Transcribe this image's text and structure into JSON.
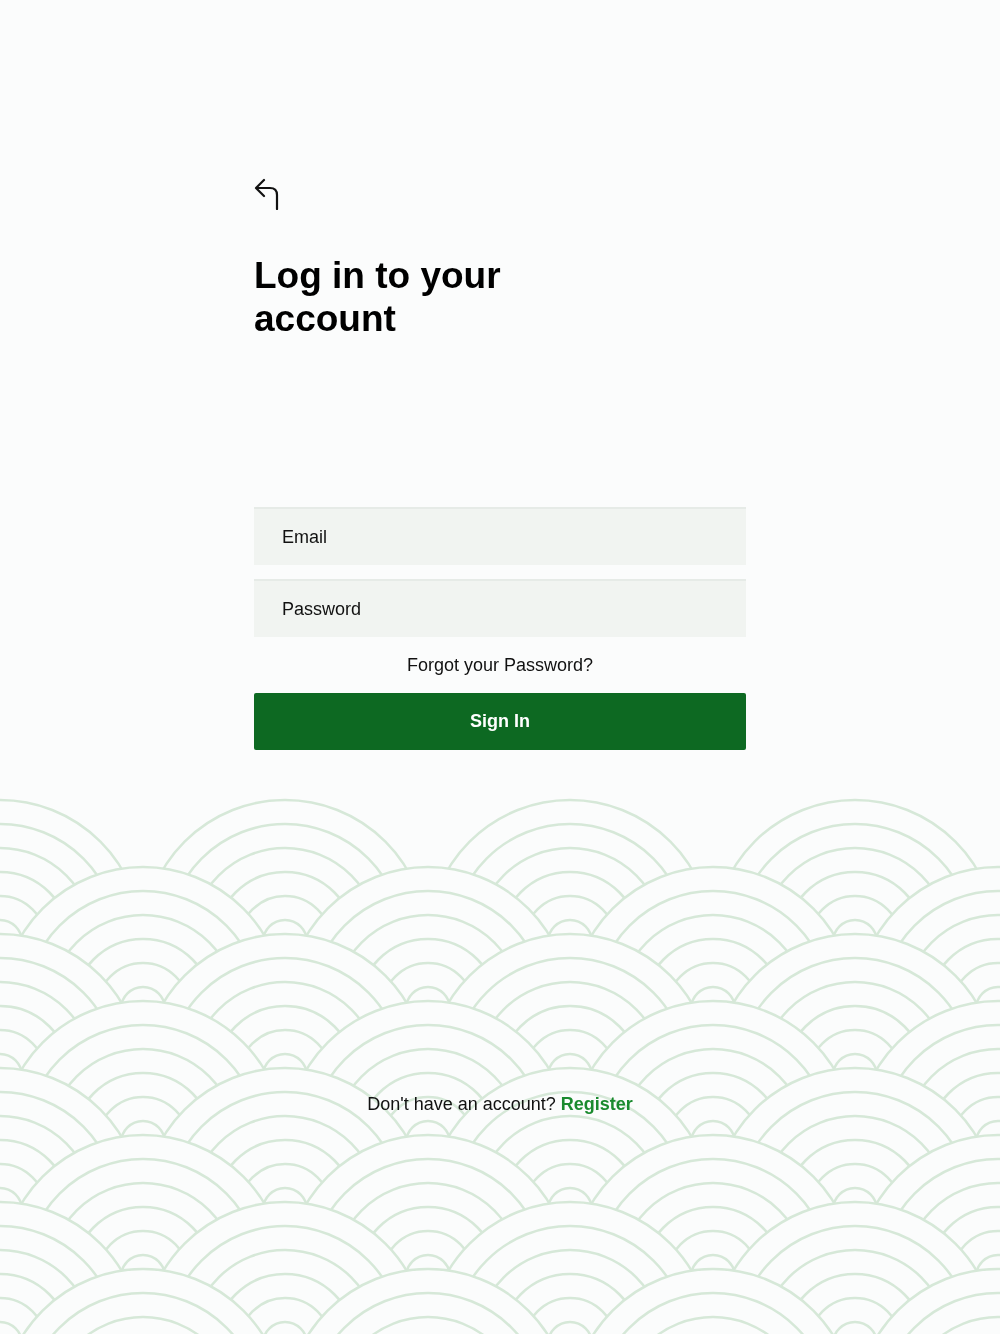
{
  "title": "Log in to your account",
  "fields": [
    {
      "placeholder": "Email"
    },
    {
      "placeholder": "Password"
    }
  ],
  "forgot_link": "Forgot your Password?",
  "sign_in_button": "Sign In",
  "register": {
    "prompt": "Don't have an account?",
    "link": "Register"
  }
}
